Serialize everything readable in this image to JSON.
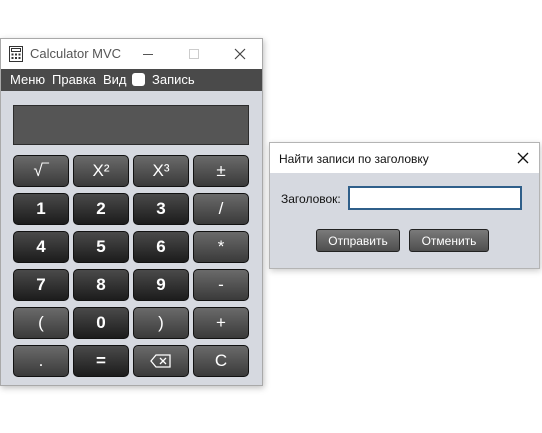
{
  "calculator": {
    "title": "Calculator MVC",
    "menu": [
      "Меню",
      "Правка",
      "Вид"
    ],
    "record_label": "Запись",
    "display_value": "",
    "keys": [
      {
        "label": "√‾",
        "name": "sqrt-key",
        "style": "alt"
      },
      {
        "label": "X²",
        "name": "square-key",
        "style": "alt"
      },
      {
        "label": "X³",
        "name": "cube-key",
        "style": "alt"
      },
      {
        "label": "±",
        "name": "plus-minus-key",
        "style": "alt"
      },
      {
        "label": "1",
        "name": "digit-1-key"
      },
      {
        "label": "2",
        "name": "digit-2-key"
      },
      {
        "label": "3",
        "name": "digit-3-key"
      },
      {
        "label": "/",
        "name": "divide-key",
        "style": "alt"
      },
      {
        "label": "4",
        "name": "digit-4-key"
      },
      {
        "label": "5",
        "name": "digit-5-key"
      },
      {
        "label": "6",
        "name": "digit-6-key"
      },
      {
        "label": "*",
        "name": "multiply-key",
        "style": "alt"
      },
      {
        "label": "7",
        "name": "digit-7-key"
      },
      {
        "label": "8",
        "name": "digit-8-key"
      },
      {
        "label": "9",
        "name": "digit-9-key"
      },
      {
        "label": "-",
        "name": "minus-key",
        "style": "alt"
      },
      {
        "label": "(",
        "name": "open-paren-key",
        "style": "alt"
      },
      {
        "label": "0",
        "name": "digit-0-key"
      },
      {
        "label": ")",
        "name": "close-paren-key",
        "style": "alt"
      },
      {
        "label": "+",
        "name": "plus-key",
        "style": "alt"
      },
      {
        "label": ".",
        "name": "decimal-key",
        "style": "alt"
      },
      {
        "label": "=",
        "name": "equals-key"
      },
      {
        "label": "",
        "name": "backspace-key",
        "icon": "backspace-icon",
        "style": "alt"
      },
      {
        "label": "C",
        "name": "clear-key",
        "style": "alt"
      }
    ]
  },
  "dialog": {
    "title": "Найти записи по заголовку",
    "field_label": "Заголовок:",
    "field_value": "",
    "submit_label": "Отправить",
    "cancel_label": "Отменить"
  },
  "icons": {
    "app": "calculator-icon",
    "minimize": "minimize-icon",
    "maximize": "maximize-icon",
    "close": "close-icon",
    "backspace": "backspace-icon"
  },
  "colors": {
    "menubar": "#4a4a4a",
    "window_bg": "#d6d9e0",
    "key_dark": "#1c1c1c",
    "input_border": "#2f5f8a"
  }
}
